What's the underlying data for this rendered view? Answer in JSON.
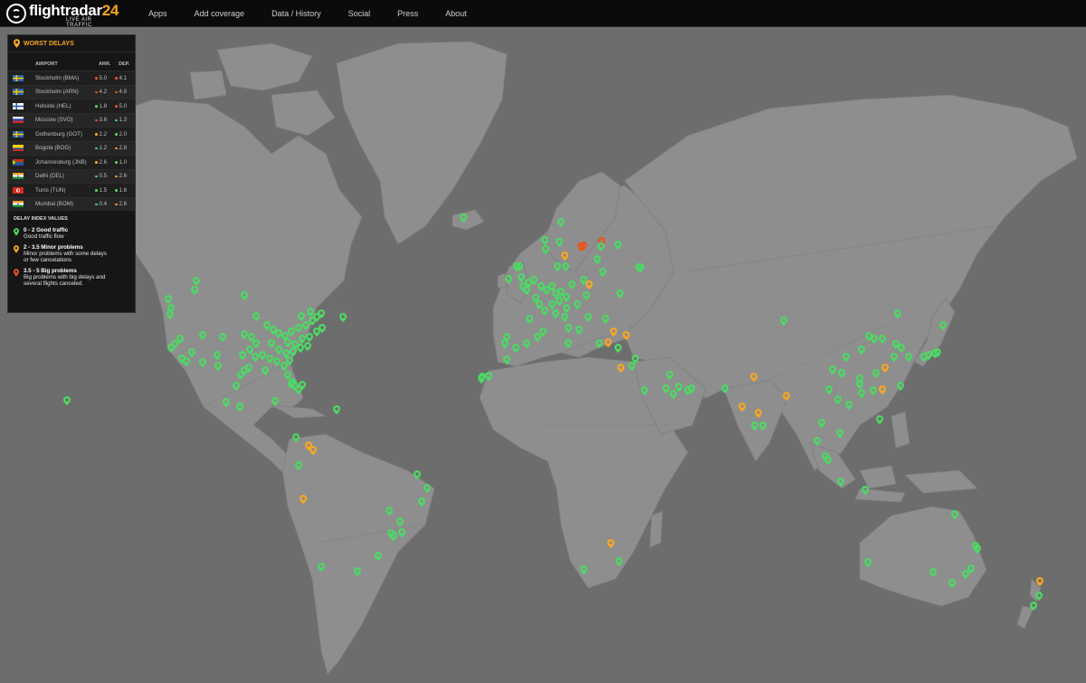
{
  "brand": {
    "name": "flightradar",
    "number": "24",
    "tagline": "LIVE AIR TRAFFIC"
  },
  "nav": [
    "Apps",
    "Add coverage",
    "Data / History",
    "Social",
    "Press",
    "About"
  ],
  "colors": {
    "good": "#4cd964",
    "minor": "#f5a623",
    "big": "#e8541c",
    "land": "#909090",
    "ocean": "#6d6d6d"
  },
  "panel": {
    "title": "WORST DELAYS",
    "col_airport": "AIRPORT",
    "col_arr": "ARR.",
    "col_dep": "DEP.",
    "rows": [
      {
        "airport": "Stockholm (BMA)",
        "arr": "5.0",
        "dep": "4.1",
        "arr_level": "big",
        "dep_level": "big",
        "flag": "se"
      },
      {
        "airport": "Stockholm (ARN)",
        "arr": "4.2",
        "dep": "4.9",
        "arr_level": "big",
        "dep_level": "big",
        "flag": "se"
      },
      {
        "airport": "Helsinki (HEL)",
        "arr": "1.8",
        "dep": "5.0",
        "arr_level": "good",
        "dep_level": "big",
        "flag": "fi"
      },
      {
        "airport": "Moscow (SVO)",
        "arr": "3.6",
        "dep": "1.3",
        "arr_level": "big",
        "dep_level": "good",
        "flag": "ru"
      },
      {
        "airport": "Gothenburg (GOT)",
        "arr": "2.2",
        "dep": "2.0",
        "arr_level": "minor",
        "dep_level": "good",
        "flag": "se"
      },
      {
        "airport": "Bogota (BOG)",
        "arr": "1.2",
        "dep": "2.8",
        "arr_level": "good",
        "dep_level": "minor",
        "flag": "co"
      },
      {
        "airport": "Johannesburg (JNB)",
        "arr": "2.6",
        "dep": "1.0",
        "arr_level": "minor",
        "dep_level": "good",
        "flag": "za"
      },
      {
        "airport": "Delhi (DEL)",
        "arr": "0.5",
        "dep": "2.6",
        "arr_level": "good",
        "dep_level": "minor",
        "flag": "in"
      },
      {
        "airport": "Tunis (TUN)",
        "arr": "1.5",
        "dep": "1.6",
        "arr_level": "good",
        "dep_level": "good",
        "flag": "tn"
      },
      {
        "airport": "Mumbai (BOM)",
        "arr": "0.4",
        "dep": "2.6",
        "arr_level": "good",
        "dep_level": "minor",
        "flag": "in"
      }
    ],
    "legend_title": "DELAY INDEX VALUES",
    "legend": [
      {
        "level": "good",
        "title": "0 - 2 Good traffic",
        "desc": [
          "Good traffic flow"
        ]
      },
      {
        "level": "minor",
        "title": "2 - 3.5 Minor problems",
        "desc": [
          "Minor problems with some delays",
          "or few cancelations"
        ]
      },
      {
        "level": "big",
        "title": "3.5 - 5 Big problems",
        "desc": [
          "Big problems with big delays and",
          "several flights canceled."
        ]
      }
    ]
  }
}
